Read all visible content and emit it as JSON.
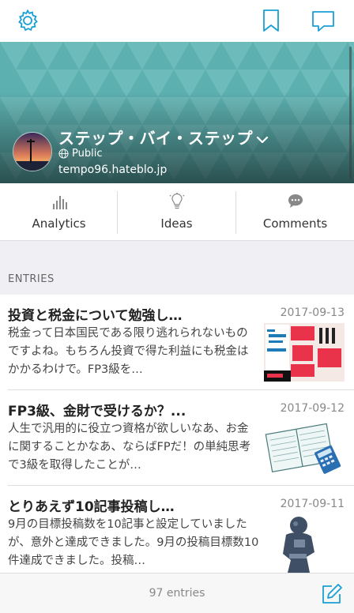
{
  "nav": {
    "settings_icon": "gear-icon",
    "bookmark_icon": "bookmark-icon",
    "comment_icon": "speech-bubble-icon",
    "icon_color": "#1a9fd4"
  },
  "blog": {
    "title": "ステップ・バイ・ステップ",
    "visibility": "Public",
    "url": "tempo96.hateblo.jp",
    "header_color": "#5fb3b3"
  },
  "tabs": [
    {
      "label": "Analytics",
      "icon": "bar-chart-icon"
    },
    {
      "label": "Ideas",
      "icon": "lightbulb-icon"
    },
    {
      "label": "Comments",
      "icon": "chat-bubble-icon"
    }
  ],
  "section": {
    "label": "ENTRIES"
  },
  "entries": [
    {
      "title": "投資と税金について勉強し…",
      "date": "2017-09-13",
      "excerpt": "税金って日本国民である限り逃れられないものですよね。もちろん投資で得た利益にも税金はかかるわけで。FP3級を…"
    },
    {
      "title": "FP3級、金財で受けるか？...",
      "date": "2017-09-12",
      "excerpt": "人生で汎用的に役立つ資格が欲しいなあ、お金に関することかなあ、ならばFPだ！の単純思考で3級を取得したことが…"
    },
    {
      "title": "とりあえず10記事投稿し…",
      "date": "2017-09-11",
      "excerpt": "9月の目標投稿数を10記事と設定していましたが、意外と達成できました。9月の投稿目標数10件達成できました。投稿…"
    }
  ],
  "footer": {
    "count": "97 entries",
    "compose_icon": "compose-icon"
  }
}
